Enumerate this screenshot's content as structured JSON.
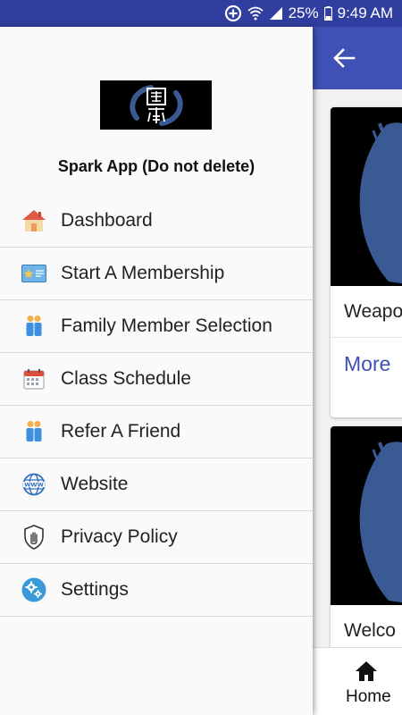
{
  "status_bar": {
    "battery_percent": "25%",
    "time": "9:49 AM"
  },
  "drawer": {
    "app_name": "Spark App (Do not delete)",
    "items": [
      {
        "label": "Dashboard",
        "icon": "house-icon"
      },
      {
        "label": "Start A Membership",
        "icon": "membership-card-icon"
      },
      {
        "label": "Family Member Selection",
        "icon": "people-icon"
      },
      {
        "label": "Class Schedule",
        "icon": "calendar-icon"
      },
      {
        "label": "Refer A Friend",
        "icon": "people-icon"
      },
      {
        "label": "Website",
        "icon": "globe-www-icon"
      },
      {
        "label": "Privacy Policy",
        "icon": "shield-hand-icon"
      },
      {
        "label": "Settings",
        "icon": "gears-icon"
      }
    ]
  },
  "background": {
    "cards": [
      {
        "title": "Weapo",
        "more": "More"
      },
      {
        "title": "Welco"
      }
    ],
    "bottom_nav": {
      "home_label": "Home"
    }
  },
  "colors": {
    "status_bar": "#303f9f",
    "app_bar": "#3f51b5",
    "accent": "#3f51b5"
  }
}
